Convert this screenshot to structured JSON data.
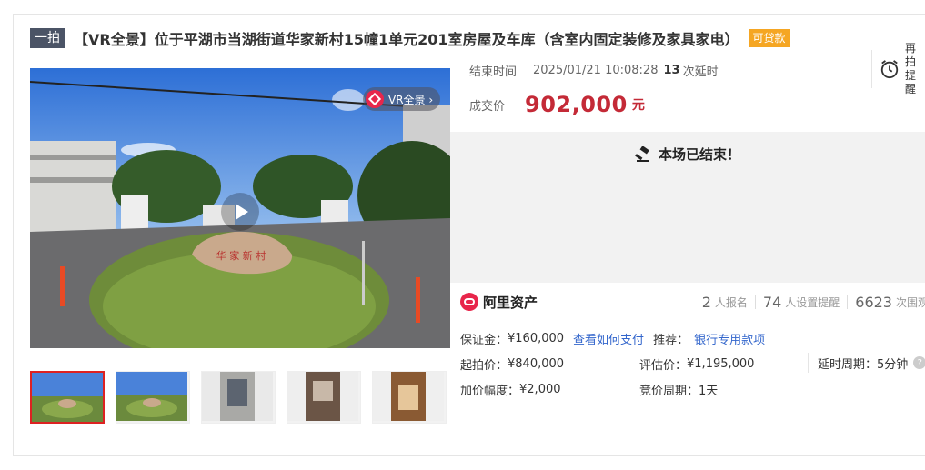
{
  "header": {
    "tag": "一拍",
    "title": "【VR全景】位于平湖市当湖街道华家新村15幢1单元201室房屋及车库（含室内固定装修及家具家电）",
    "loan_badge": "可贷款"
  },
  "media": {
    "vr_label": "VR全景 ›",
    "rock_text": "华 家 新 村",
    "play_icon": "play-icon"
  },
  "thumbnails": [
    {
      "alt": "exterior-1"
    },
    {
      "alt": "exterior-2"
    },
    {
      "alt": "interior-1"
    },
    {
      "alt": "interior-2"
    },
    {
      "alt": "interior-3"
    }
  ],
  "auction": {
    "end_label": "结束时间",
    "end_time": "2025/01/21 10:08:28",
    "delay_count": "13",
    "delay_suffix": "次延时",
    "deal_label": "成交价",
    "deal_price": "902,000",
    "deal_unit": "元",
    "remind_line1": "再拍",
    "remind_line2": "提醒",
    "ended_text": "本场已结束！"
  },
  "seller": {
    "name": "阿里资产",
    "stats": [
      {
        "num": "2",
        "label": "人报名"
      },
      {
        "num": "74",
        "label": "人设置提醒"
      },
      {
        "num": "6623",
        "label": "次围观"
      }
    ]
  },
  "details": {
    "deposit_label": "保证金：",
    "deposit_value": "¥160,000",
    "deposit_link": "查看如何支付",
    "recommend_label": "推荐：",
    "recommend_link": "银行专用款项",
    "start_label": "起拍价：",
    "start_value": "¥840,000",
    "appraise_label": "评估价：",
    "appraise_value": "¥1,195,000",
    "delay_period_label": "延时周期：",
    "delay_period_value": "5分钟",
    "increment_label": "加价幅度：",
    "increment_value": "¥2,000",
    "bid_period_label": "竞价周期：",
    "bid_period_value": "1天"
  },
  "colors": {
    "accent_red": "#c42a37",
    "badge_orange": "#f5a623",
    "link_blue": "#3366cc"
  }
}
